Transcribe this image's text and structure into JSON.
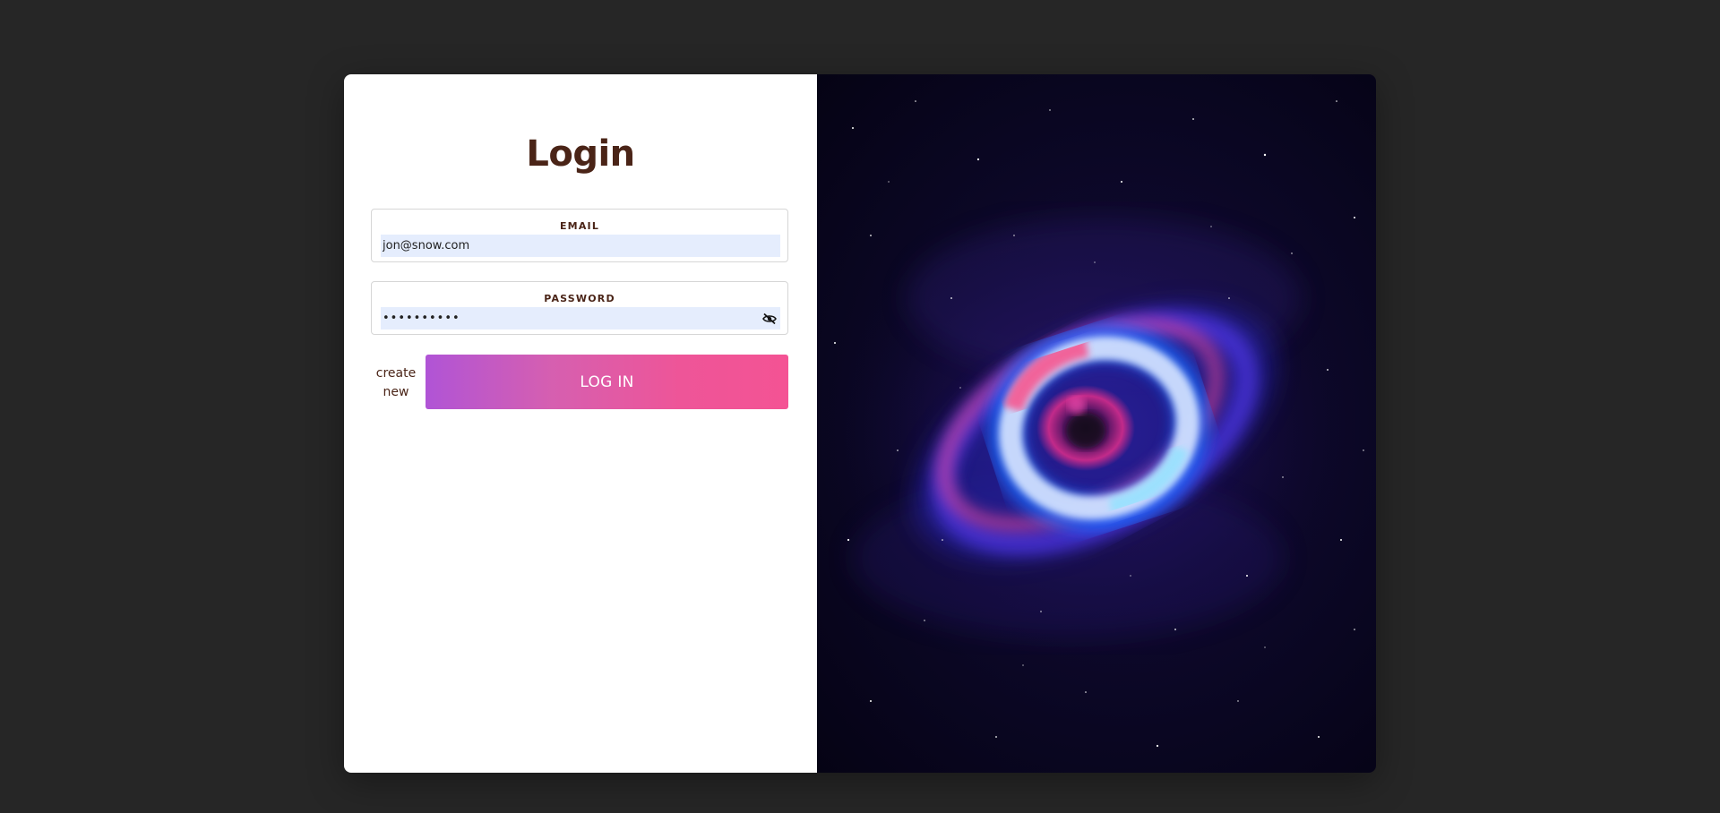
{
  "login": {
    "title": "Login",
    "email": {
      "label": "EMAIL",
      "value": "jon@snow.com"
    },
    "password": {
      "label": "PASSWORD",
      "value": "••••••••••",
      "toggle_icon": "eye-slash-icon"
    },
    "create_new_label": "create new",
    "submit_label": "LOG IN"
  },
  "hero_image": {
    "subject": "galaxy-eye-nebula",
    "colors": {
      "background": "#0b0725",
      "ring_outer": "#2a4cff",
      "ring_white": "#e9e6ff",
      "ring_pink": "#ff3d8a",
      "core": "#7a1a7a"
    }
  },
  "theme": {
    "page_background": "#262626",
    "heading_color": "#4a2417",
    "input_fill": "#e5edfd",
    "button_gradient_start": "#b054d6",
    "button_gradient_end": "#f45394"
  }
}
